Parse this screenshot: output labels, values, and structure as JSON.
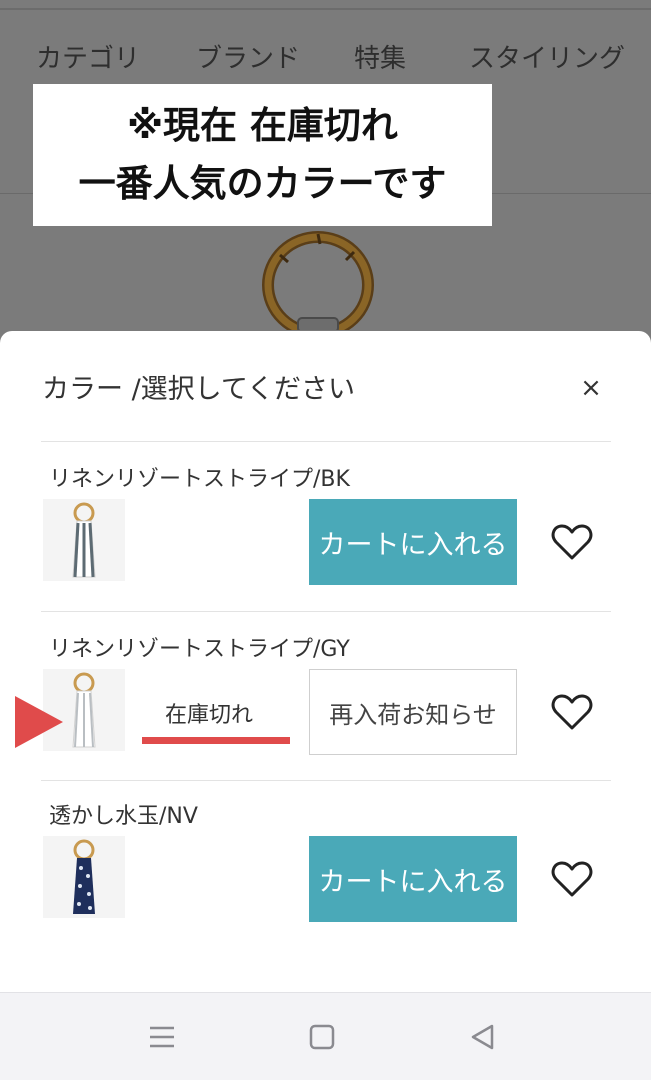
{
  "background": {
    "nav": [
      "カテゴリ",
      "ブランド",
      "特集",
      "スタイリング"
    ]
  },
  "promo": {
    "line1": "※現在 在庫切れ",
    "line2": "一番人気のカラーです"
  },
  "sheet": {
    "title": "カラー /選択してください",
    "close_symbol": "×",
    "items": [
      {
        "name": "リネンリゾートストライプ/BK",
        "button_label": "カートに入れる",
        "thumb_icon": "stripe-scarf-black-thumbnail",
        "favorite_icon": "heart-outline-icon"
      },
      {
        "name": "リネンリゾートストライプ/GY",
        "stock_status": "在庫切れ",
        "button_label": "再入荷お知らせ",
        "thumb_icon": "stripe-scarf-gray-thumbnail",
        "favorite_icon": "heart-outline-icon"
      },
      {
        "name": "透かし水玉/NV",
        "button_label": "カートに入れる",
        "thumb_icon": "dot-scarf-navy-thumbnail",
        "favorite_icon": "heart-outline-icon"
      }
    ]
  },
  "android_nav": {
    "icons": [
      "menu-icon",
      "home-square-icon",
      "back-triangle-icon"
    ]
  },
  "colors": {
    "accent": "#4aa9b8",
    "annotation_red": "#e04b4b",
    "overlay": "#7b7b7b"
  }
}
